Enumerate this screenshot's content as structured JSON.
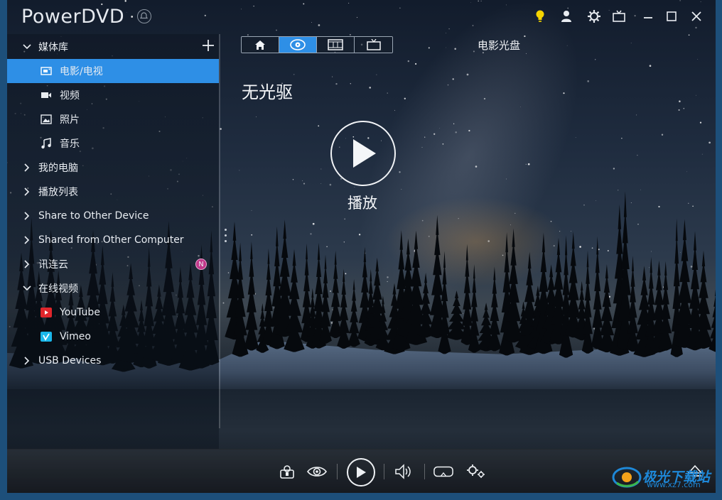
{
  "window": {
    "title": "PowerDVD"
  },
  "titlebar_icons": [
    "notification-bell-icon",
    "lightbulb-icon",
    "user-icon",
    "settings-gear-icon",
    "tv-mode-icon",
    "minimize-icon",
    "maximize-icon",
    "close-icon"
  ],
  "colors": {
    "accent": "#2e8fe6",
    "bulb": "#f5d400",
    "badge": "#c0378a",
    "watermark": "#1e88d8"
  },
  "sidebar": {
    "media_library": {
      "label": "媒体库",
      "items": [
        {
          "label": "电影/电视",
          "icon": "film-tv-icon",
          "active": true
        },
        {
          "label": "视频",
          "icon": "video-camera-icon"
        },
        {
          "label": "照片",
          "icon": "photo-icon"
        },
        {
          "label": "音乐",
          "icon": "music-note-icon"
        }
      ]
    },
    "groups": [
      {
        "label": "我的电脑"
      },
      {
        "label": "播放列表"
      },
      {
        "label": "Share to Other Device"
      },
      {
        "label": "Shared from Other Computer"
      },
      {
        "label": "讯连云",
        "badge": "N"
      }
    ],
    "online_video": {
      "label": "在线视频",
      "items": [
        {
          "label": "YouTube",
          "icon": "youtube-icon"
        },
        {
          "label": "Vimeo",
          "icon": "vimeo-icon"
        }
      ]
    },
    "usb": {
      "label": "USB Devices"
    }
  },
  "tabs": [
    {
      "icon": "home-icon"
    },
    {
      "icon": "disc-icon",
      "active": true
    },
    {
      "icon": "film-strip-icon"
    },
    {
      "icon": "tv-icon"
    }
  ],
  "main": {
    "section_title": "电影光盘",
    "status": "无光驱",
    "play_label": "播放"
  },
  "controls": [
    "snapshot-icon",
    "eye-view-icon",
    "play-icon",
    "volume-icon",
    "vr-headset-icon",
    "settings-gears-icon",
    "eject-icon"
  ],
  "watermark": {
    "text": "极光下载站",
    "url": "www.xz7.com"
  }
}
